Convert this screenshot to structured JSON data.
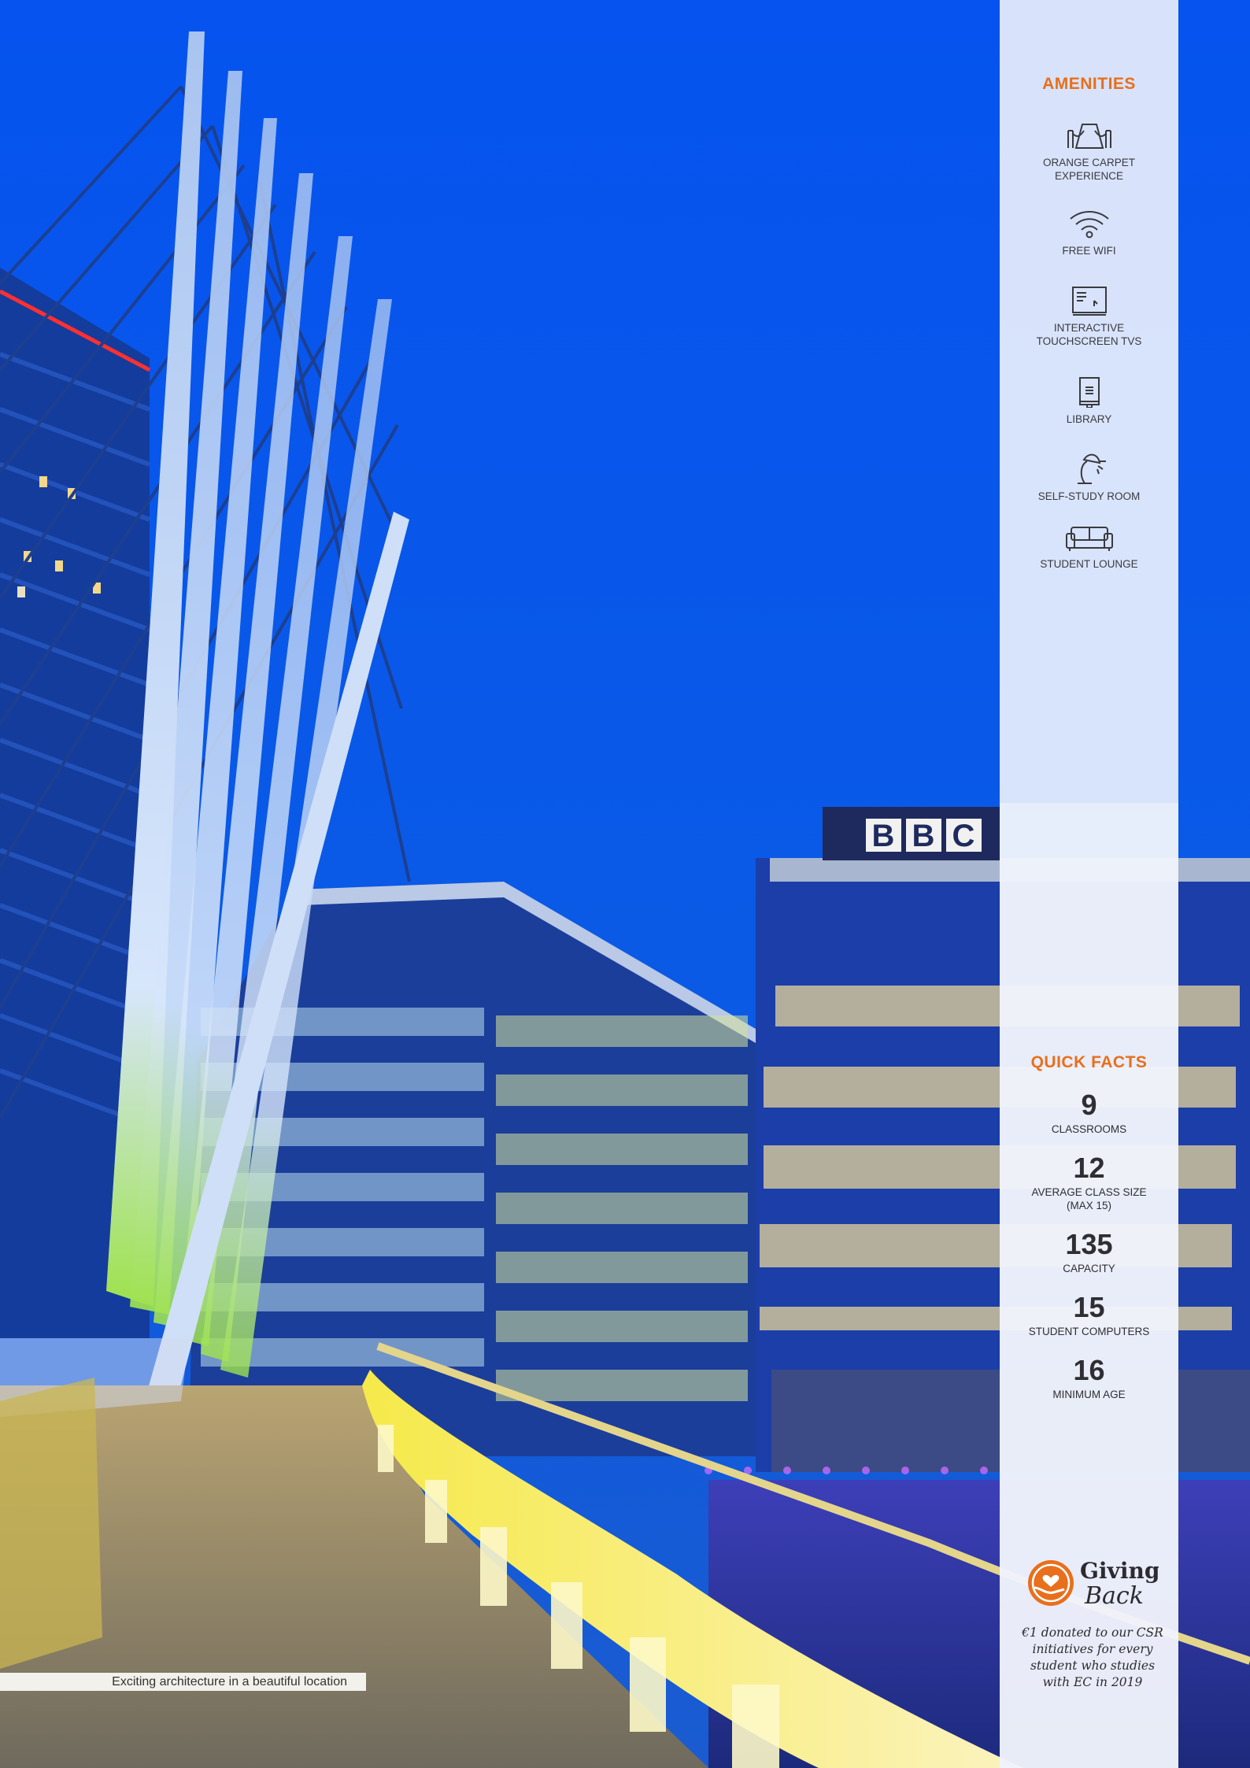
{
  "caption": "Exciting architecture in a beautiful location",
  "colors": {
    "accent": "#e86f1c",
    "sky": "#0a55e8",
    "panel": "#eaf0fc"
  },
  "amenities": {
    "title": "AMENITIES",
    "items": [
      {
        "icon": "carpet-icon",
        "label_line1": "ORANGE CARPET",
        "label_line2": "EXPERIENCE"
      },
      {
        "icon": "wifi-icon",
        "label_line1": "FREE WIFI",
        "label_line2": ""
      },
      {
        "icon": "touchscreen-tv-icon",
        "label_line1": "INTERACTIVE",
        "label_line2": "TOUCHSCREEN TVS"
      },
      {
        "icon": "book-icon",
        "label_line1": "LIBRARY",
        "label_line2": ""
      },
      {
        "icon": "desk-lamp-icon",
        "label_line1": "SELF-STUDY ROOM",
        "label_line2": ""
      },
      {
        "icon": "sofa-icon",
        "label_line1": "STUDENT LOUNGE",
        "label_line2": ""
      }
    ]
  },
  "quick_facts": {
    "title": "QUICK FACTS",
    "items": [
      {
        "value": "9",
        "label_line1": "CLASSROOMS",
        "label_line2": ""
      },
      {
        "value": "12",
        "label_line1": "AVERAGE CLASS SIZE",
        "label_line2": "(MAX 15)"
      },
      {
        "value": "135",
        "label_line1": "CAPACITY",
        "label_line2": ""
      },
      {
        "value": "15",
        "label_line1": "STUDENT COMPUTERS",
        "label_line2": ""
      },
      {
        "value": "16",
        "label_line1": "MINIMUM AGE",
        "label_line2": ""
      }
    ]
  },
  "giving_back": {
    "logo_word1": "Giving",
    "logo_word2": "Back",
    "line1": "€1 donated to our CSR",
    "line2": "initiatives for every",
    "line3": "student who studies",
    "line4": "with EC in 2019"
  },
  "building_sign": "BBC"
}
